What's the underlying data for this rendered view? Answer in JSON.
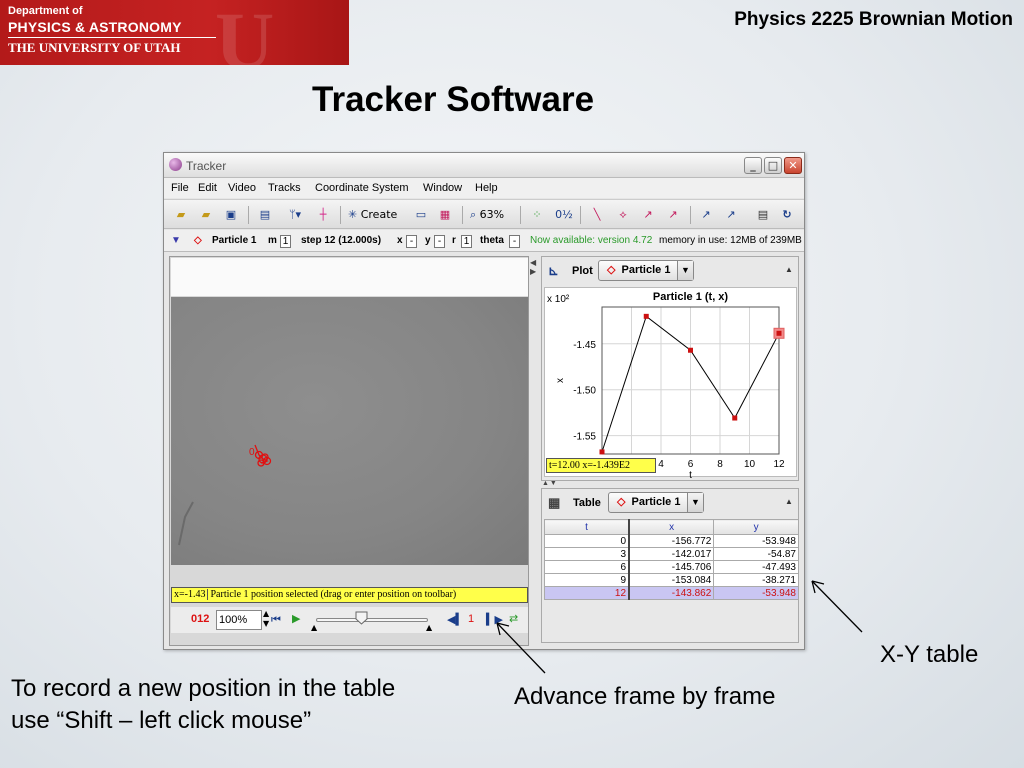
{
  "logo": {
    "line1": "Department of",
    "line2": "PHYSICS & ASTRONOMY",
    "line3": "THE UNIVERSITY OF UTAH"
  },
  "course_title": "Physics 2225  Brownian Motion",
  "slide_title": "Tracker Software",
  "window": {
    "title": "Tracker",
    "controls": [
      "minimize-icon",
      "maximize-icon",
      "close-icon"
    ]
  },
  "menu": [
    "File",
    "Edit",
    "Video",
    "Tracks",
    "Coordinate System",
    "Window",
    "Help"
  ],
  "toolbar": {
    "create_label": "Create",
    "zoom_label": "63%",
    "icons": [
      "open-icon",
      "open-recent-icon",
      "save-icon",
      "clip-settings-icon",
      "calibration-icon",
      "axes-icon",
      "create-icon",
      "trails-icon",
      "mark-icon",
      "zoom-icon",
      "points-icon",
      "vector-icon",
      "track-icon",
      "velocity-icon",
      "acceleration-icon",
      "vector-sum-icon",
      "mass-icon",
      "notes-icon",
      "refresh-icon"
    ]
  },
  "trackbar": {
    "track_name": "Particle 1",
    "m_label": "m",
    "m_value": "1",
    "step_label": "step 12 (12.000s)",
    "x_label": "x",
    "x_value": "-",
    "y_label": "y",
    "y_value": "-",
    "r_label": "r",
    "r_value": "1",
    "theta_label": "theta",
    "theta_value": "-",
    "available": "Now available: version 4.72",
    "memory": "memory in use: 12MB of 239MB"
  },
  "video": {
    "marker_label": "0",
    "status_x": "x=-1.43",
    "status_msg": "Particle 1 position selected (drag or enter position on toolbar)"
  },
  "player": {
    "frame": "012",
    "zoom": "100%",
    "step_size": "1"
  },
  "plot_panel": {
    "view_label": "Plot",
    "track": "Particle 1",
    "readout": "t=12.00  x=-1.439E2"
  },
  "chart_data": {
    "type": "line",
    "title": "Particle 1 (t, x)",
    "xlabel": "t",
    "ylabel": "x",
    "y_multiplier": "x 10²",
    "x": [
      0,
      3,
      6,
      9,
      12
    ],
    "series": [
      {
        "name": "Particle 1",
        "values": [
          -156.772,
          -142.017,
          -145.706,
          -153.084,
          -143.862
        ]
      }
    ],
    "xlim": [
      0,
      12
    ],
    "ylim": [
      -157,
      -141
    ],
    "x_ticks": [
      0,
      2,
      4,
      6,
      8,
      10,
      12
    ],
    "y_ticks": [
      -1.45,
      -1.5,
      -1.55
    ],
    "y_tick_values": [
      -145,
      -150,
      -155
    ],
    "grid": true,
    "highlight_index": 4
  },
  "table_panel": {
    "view_label": "Table",
    "track": "Particle 1",
    "columns": [
      "t",
      "x",
      "y"
    ],
    "rows": [
      [
        "0",
        "-156.772",
        "-53.948"
      ],
      [
        "3",
        "-142.017",
        "-54.87"
      ],
      [
        "6",
        "-145.706",
        "-47.493"
      ],
      [
        "9",
        "-153.084",
        "-38.271"
      ],
      [
        "12",
        "-143.862",
        "-53.948"
      ]
    ],
    "selected_row": 4
  },
  "annotations": {
    "xy_table": "X-Y table",
    "advance": "Advance frame by frame",
    "record_line1": "To record a new position in the table",
    "record_line2": "use “Shift – left click mouse”"
  },
  "colors": {
    "logo_red": "#c52222",
    "track_red": "#dd1111",
    "status_yellow": "#ffff4a",
    "selected_row": "#c9c6f2",
    "available_green": "#2a9a2a"
  }
}
